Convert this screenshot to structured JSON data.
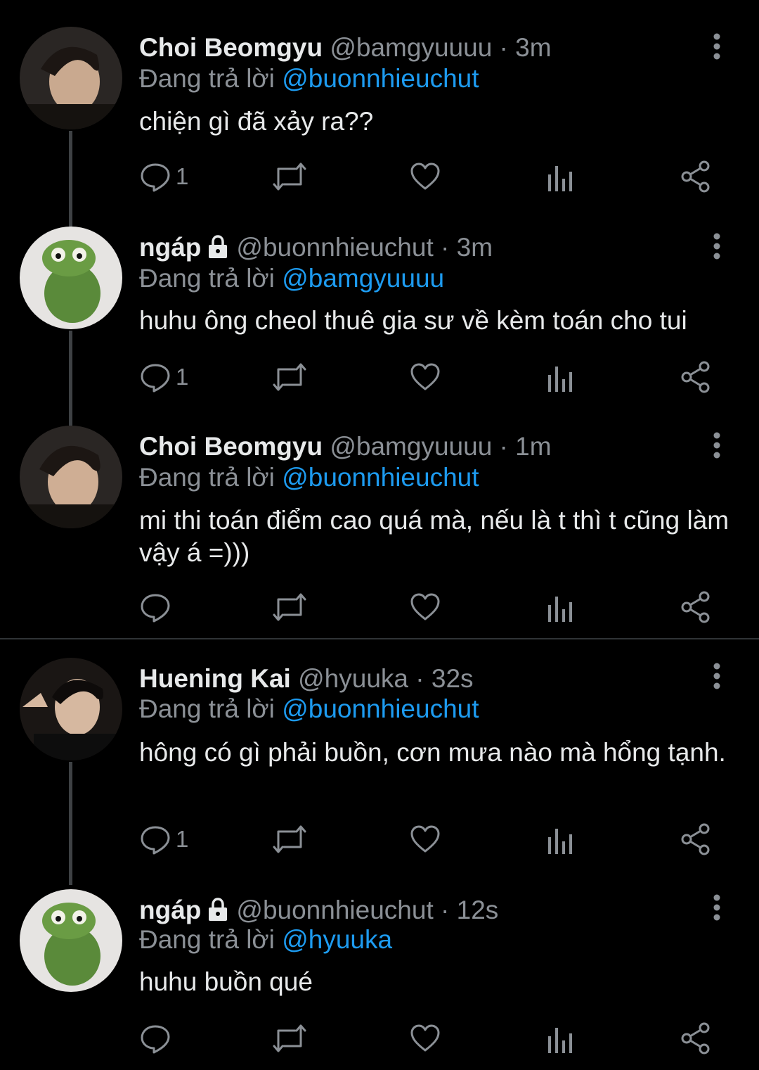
{
  "replying_prefix": "Đang trả lời",
  "tweets": [
    {
      "name": "Choi Beomgyu",
      "handle": "@bamgyuuuu",
      "time": "3m",
      "locked": false,
      "replying_to": "@buonnhieuchut",
      "text": "chiện gì đã xảy ra??",
      "reply_count": "1"
    },
    {
      "name": "ngáp",
      "handle": "@buonnhieuchut",
      "time": "3m",
      "locked": true,
      "replying_to": "@bamgyuuuu",
      "text": "huhu ông cheol thuê gia sư về kèm toán cho tui",
      "reply_count": "1"
    },
    {
      "name": "Choi Beomgyu",
      "handle": "@bamgyuuuu",
      "time": "1m",
      "locked": false,
      "replying_to": "@buonnhieuchut",
      "text": "mi thi toán điểm cao quá mà, nếu là t thì t cũng làm vậy á =)))",
      "reply_count": ""
    },
    {
      "name": "Huening Kai",
      "handle": "@hyuuka",
      "time": "32s",
      "locked": false,
      "replying_to": "@buonnhieuchut",
      "text": "hông có gì phải buồn, cơn mưa nào mà hổng tạnh.",
      "reply_count": "1"
    },
    {
      "name": "ngáp",
      "handle": "@buonnhieuchut",
      "time": "12s",
      "locked": true,
      "replying_to": "@hyuuka",
      "text": "huhu buồn qué",
      "reply_count": ""
    }
  ],
  "colors": {
    "background": "#000000",
    "mention": "#1d9bf0",
    "muted": "#8b9096",
    "text": "#e7e9ea"
  }
}
